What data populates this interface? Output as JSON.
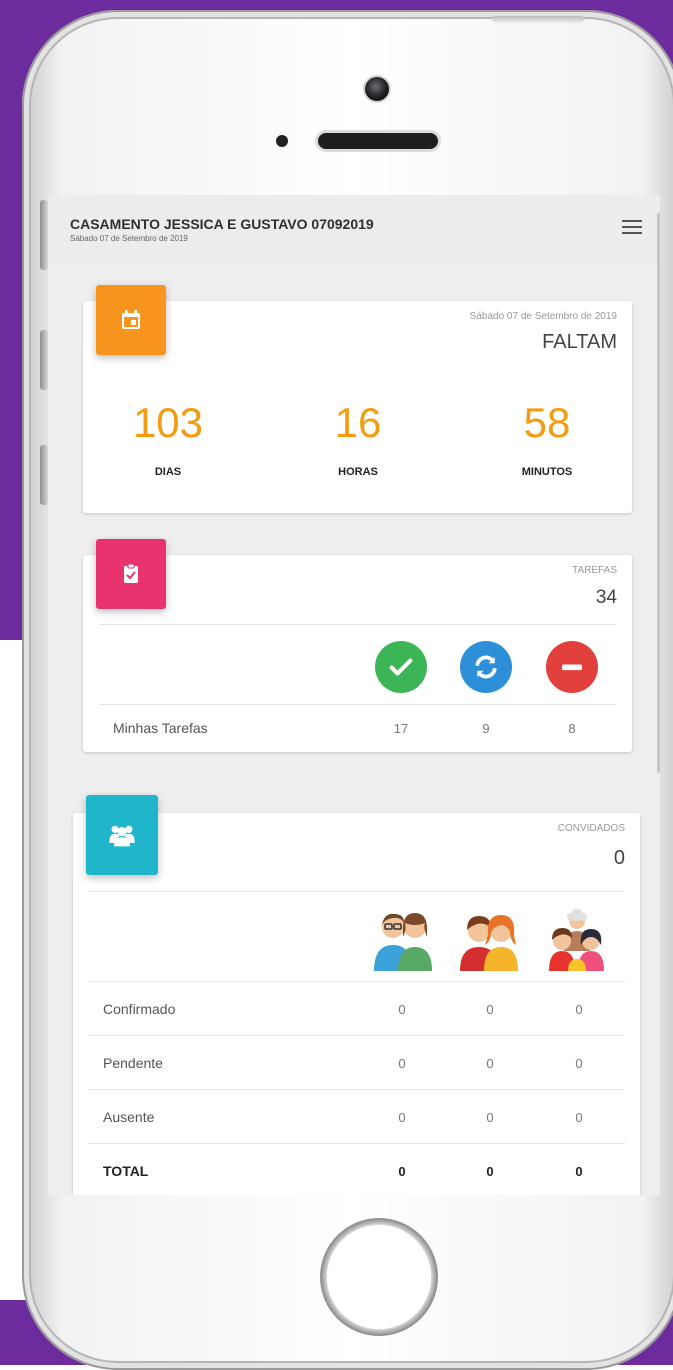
{
  "app": {
    "title": "CASAMENTO JESSICA E GUSTAVO 07092019",
    "subtitle": "Sábado 07 de Setembro de 2019",
    "menu_icon": "hamburger-menu-icon"
  },
  "countdown": {
    "icon": "calendar-icon",
    "color": "#f7941d",
    "date": "Sábado 07 de Setembro de 2019",
    "heading": "FALTAM",
    "units": [
      {
        "value": "103",
        "label": "DIAS"
      },
      {
        "value": "16",
        "label": "HORAS"
      },
      {
        "value": "58",
        "label": "MINUTOS"
      }
    ]
  },
  "tasks": {
    "icon": "clipboard-check-icon",
    "color": "#e8336e",
    "label": "TAREFAS",
    "total": "34",
    "status_icons": [
      {
        "name": "done-check-icon",
        "color": "#3cb556"
      },
      {
        "name": "in-progress-sync-icon",
        "color": "#2e8fd9"
      },
      {
        "name": "blocked-minus-icon",
        "color": "#e2403c"
      }
    ],
    "row": {
      "label": "Minhas Tarefas",
      "values": [
        "17",
        "9",
        "8"
      ]
    }
  },
  "guests": {
    "icon": "users-group-icon",
    "color": "#1fb6cc",
    "label": "CONVIDADOS",
    "total": "0",
    "group_icons": [
      "adult-couple-icon",
      "young-couple-icon",
      "family-icon"
    ],
    "rows": [
      {
        "label": "Confirmado",
        "values": [
          "0",
          "0",
          "0"
        ]
      },
      {
        "label": "Pendente",
        "values": [
          "0",
          "0",
          "0"
        ]
      },
      {
        "label": "Ausente",
        "values": [
          "0",
          "0",
          "0"
        ]
      },
      {
        "label": "TOTAL",
        "values": [
          "0",
          "0",
          "0"
        ]
      }
    ]
  }
}
